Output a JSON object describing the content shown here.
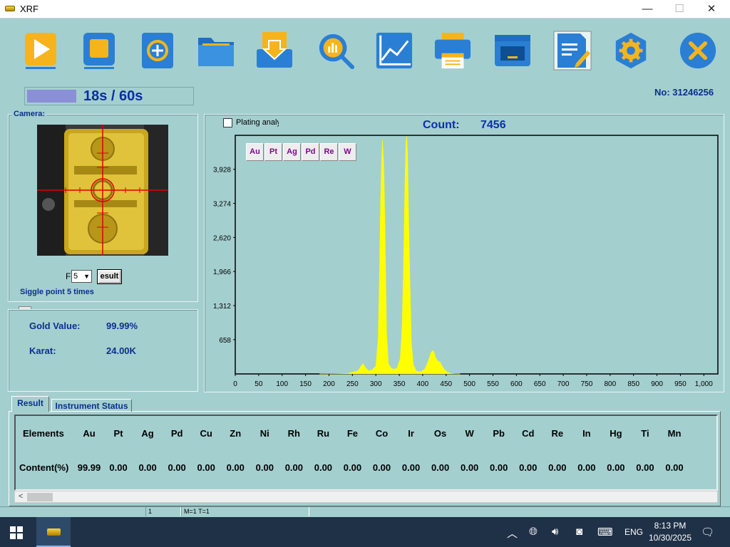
{
  "window": {
    "title": "XRF",
    "min_glyph": "—",
    "max_glyph": "☐",
    "close_glyph": "✕"
  },
  "toolbar": [
    {
      "name": "start-icon"
    },
    {
      "name": "stop-icon"
    },
    {
      "name": "refresh-add-icon"
    },
    {
      "name": "folder-icon"
    },
    {
      "name": "import-icon"
    },
    {
      "name": "analysis-search-icon"
    },
    {
      "name": "chart-line-icon"
    },
    {
      "name": "printer-icon"
    },
    {
      "name": "monitor-icon"
    },
    {
      "name": "edit-document-icon"
    },
    {
      "name": "settings-gear-icon"
    },
    {
      "name": "exit-icon"
    }
  ],
  "progress": {
    "text": "18s / 60s",
    "fraction": 0.3
  },
  "serial": "No: 31246256",
  "camera": {
    "label": "Camera:"
  },
  "controls": {
    "f_label": "F",
    "f_value": "5",
    "result_label": "esult",
    "note": "Siggle point 5 times"
  },
  "gold": {
    "value_label": "Gold Value:",
    "value": "99.99%",
    "karat_label": "Karat:",
    "karat": "24.00K"
  },
  "spectrum": {
    "plating_label": "Plating analy",
    "count_label": "Count:",
    "count_value": "7456",
    "element_buttons": [
      "Au",
      "Pt",
      "Ag",
      "Pd",
      "Re",
      "W"
    ]
  },
  "chart_data": {
    "type": "area",
    "title": "",
    "xlabel": "",
    "ylabel": "",
    "xlim": [
      0,
      1030
    ],
    "ylim": [
      0,
      4580
    ],
    "x_ticks": [
      0,
      50,
      100,
      150,
      200,
      250,
      300,
      350,
      400,
      450,
      500,
      550,
      600,
      650,
      700,
      750,
      800,
      850,
      900,
      950,
      1000
    ],
    "x_tick_labels": [
      "0",
      "50",
      "100",
      "150",
      "200",
      "250",
      "300",
      "350",
      "400",
      "450",
      "500",
      "550",
      "600",
      "650",
      "700",
      "750",
      "800",
      "850",
      "900",
      "950",
      "1,000"
    ],
    "y_ticks": [
      658,
      1312,
      1966,
      2620,
      3274,
      3928
    ],
    "y_tick_labels": [
      "658",
      "1,312",
      "1,966",
      "2,620",
      "3,274",
      "3,928"
    ],
    "fill_color": "#ffff00",
    "series": [
      {
        "x": [
          180,
          240,
          262,
          268,
          273,
          278,
          285,
          292,
          300,
          305,
          308,
          310,
          312,
          314,
          317,
          320,
          323,
          327,
          332,
          338,
          345,
          352,
          356,
          359,
          362,
          364,
          366,
          368,
          370,
          373,
          376,
          380,
          386,
          392,
          398,
          405,
          412,
          418,
          423,
          427,
          432,
          437,
          441,
          446,
          452,
          460,
          480
        ],
        "values": [
          0,
          10,
          60,
          150,
          200,
          120,
          60,
          80,
          150,
          700,
          2000,
          3300,
          4050,
          4500,
          4000,
          2600,
          800,
          200,
          120,
          90,
          110,
          300,
          900,
          2100,
          3600,
          4450,
          4560,
          4200,
          3000,
          1700,
          600,
          180,
          60,
          40,
          50,
          100,
          250,
          420,
          450,
          330,
          250,
          230,
          160,
          90,
          40,
          10,
          0
        ]
      }
    ]
  },
  "tabs": {
    "result": "Result",
    "status": "Instrument Status"
  },
  "results": {
    "elements_label": "Elements",
    "content_label": "Content(%)",
    "elements": [
      "Au",
      "Pt",
      "Ag",
      "Pd",
      "Cu",
      "Zn",
      "Ni",
      "Rh",
      "Ru",
      "Fe",
      "Co",
      "Ir",
      "Os",
      "W",
      "Pb",
      "Cd",
      "Re",
      "In",
      "Hg",
      "Ti",
      "Mn"
    ],
    "values": [
      "99.99",
      "0.00",
      "0.00",
      "0.00",
      "0.00",
      "0.00",
      "0.00",
      "0.00",
      "0.00",
      "0.00",
      "0.00",
      "0.00",
      "0.00",
      "0.00",
      "0.00",
      "0.00",
      "0.00",
      "0.00",
      "0.00",
      "0.00",
      "0.00"
    ]
  },
  "statusbar": {
    "cell1": "1",
    "cell2": "M=1 T=1"
  },
  "taskbar": {
    "lang": "ENG",
    "time": "8:13 PM",
    "date": "10/30/2025"
  }
}
